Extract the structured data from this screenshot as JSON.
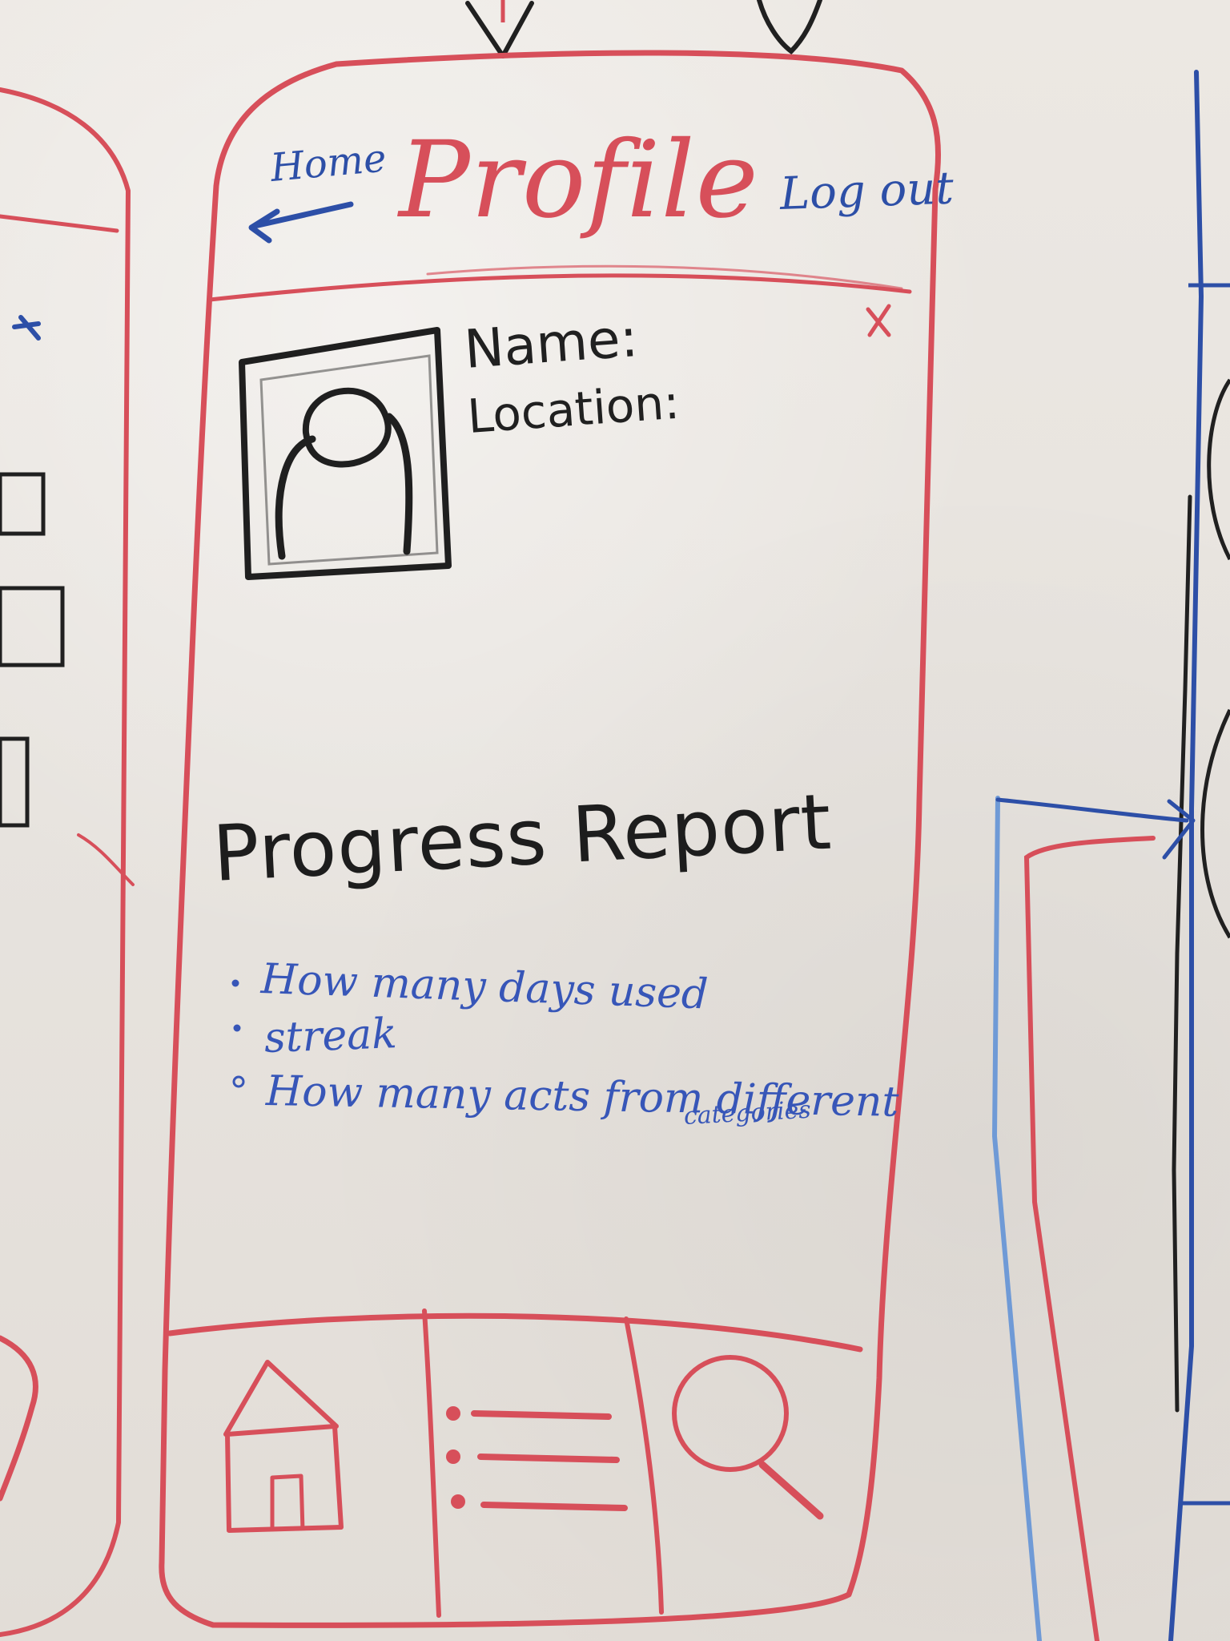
{
  "header": {
    "home_label": "Home",
    "title": "Profile",
    "logout_label": "Log out"
  },
  "profile": {
    "name_label": "Name:",
    "location_label": "Location:"
  },
  "progress_report": {
    "title": "Progress Report",
    "items": [
      "How many days used",
      "streak",
      "How many acts from different"
    ],
    "item_3_continuation": "categories"
  },
  "icons": {
    "back_arrow": "arrow-left-icon",
    "close": "close-icon",
    "avatar": "avatar-icon",
    "home": "home-icon",
    "list": "list-icon",
    "search": "search-icon"
  },
  "colors": {
    "board": "#e9e5e0",
    "red_marker": "#d74f5a",
    "blue_marker": "#3756b8",
    "black_marker": "#202020"
  }
}
